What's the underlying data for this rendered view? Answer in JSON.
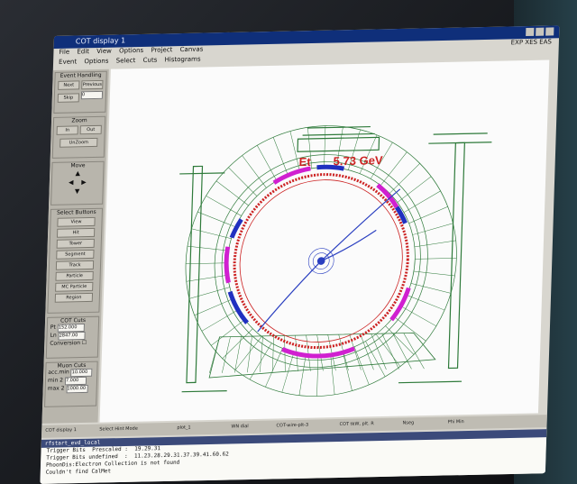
{
  "window": {
    "title": "COT display 1",
    "menu_top": [
      "File",
      "Edit",
      "View",
      "Options",
      "Project",
      "Canvas"
    ],
    "menu_top_right": "EXP XES EAS",
    "menu_second": [
      "Event",
      "Options",
      "Select",
      "Cuts",
      "Histograms"
    ]
  },
  "left_panel": {
    "event_handling": {
      "title": "Event Handling",
      "next": "Next",
      "previous": "Previous",
      "skip": "Skip",
      "skip_value": "0"
    },
    "zoom": {
      "title": "Zoom",
      "in": "In",
      "out": "Out",
      "unzoom": "UnZoom"
    },
    "move": {
      "title": "Move"
    },
    "select_buttons": {
      "title": "Select Buttons",
      "items": [
        "View",
        "Hit",
        "Tower",
        "Segment",
        "Track",
        "Particle",
        "MC Particle",
        "Region"
      ]
    },
    "cot_cuts": {
      "title": "COT Cuts",
      "pt_label": "Pt",
      "pt_value": "152.000",
      "ln_label": "Ln",
      "ln_value": "2847.00",
      "conversion": "Conversion"
    },
    "muon_cuts": {
      "title": "Muon Cuts",
      "rows": [
        {
          "label": "acc.min",
          "value": "10.000"
        },
        {
          "label": "min 2",
          "value": "7.000"
        },
        {
          "label": "max 2",
          "value": "1000.00"
        }
      ]
    }
  },
  "canvas": {
    "et_label": "Et",
    "energy_label": "5.73 GeV"
  },
  "status_bar": [
    "COT display 1",
    "Select Hint Mode",
    "plot_1",
    "WN dial",
    "COT-wire-plt-3",
    "COT tkW, plt. R",
    "Nseg",
    "Phi Min"
  ],
  "terminal": {
    "title": "rfstart_evd_local",
    "lines": [
      "Trigger Bits  Prescaled :  19.29.31",
      "Trigger Bits undefined  :  11.23.28.29.31.37.39.41.60.62",
      "PhoonDis:Electron Collection is not found",
      "Couldn't find CalMet"
    ]
  },
  "colors": {
    "track_red": "#cc2222",
    "track_blue": "#2a3fc0",
    "detector_green": "#2e7a3a",
    "calo_magenta": "#d020d0",
    "calo_blue": "#2030c0"
  }
}
